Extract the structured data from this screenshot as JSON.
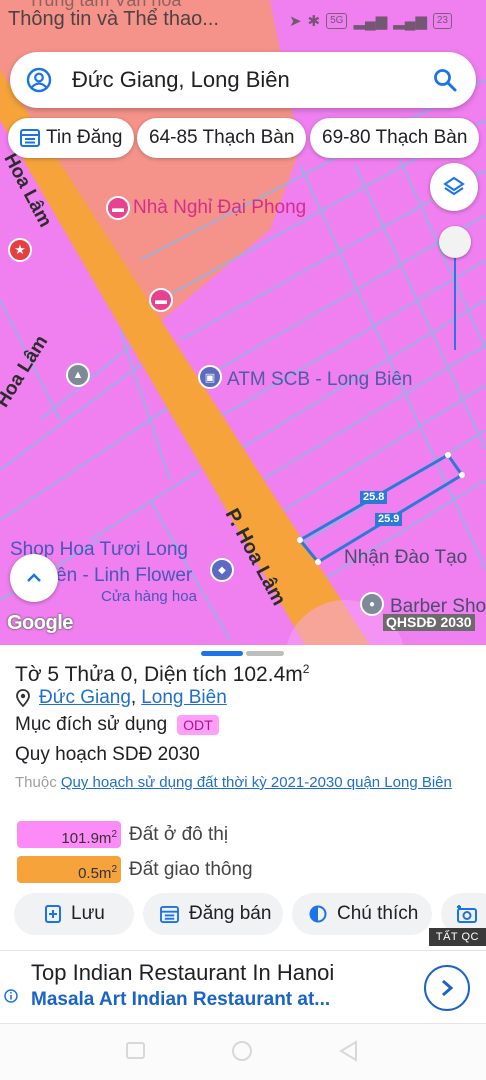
{
  "status_bar": {
    "text": "Thông tin và Thể thao...",
    "ghost_text": "Trung tâm Văn hóa",
    "network_label": "5G",
    "battery_label": "23"
  },
  "search": {
    "query": "Đức Giang, Long Biên"
  },
  "chips": [
    {
      "label": "Tin Đăng",
      "icon": "listing-icon"
    },
    {
      "label": "64-85 Thạch Bàn"
    },
    {
      "label": "69-80 Thạch Bàn"
    }
  ],
  "map": {
    "colors": {
      "residential": "#f07ff0",
      "commercial": "#f5938a",
      "road": "#f5a33a",
      "parcel_line": "#8fb6e6",
      "measure_line": "#2b7ad6"
    },
    "road_labels": [
      "Hoa Lâm",
      "Hoa Lâm",
      "P. Hoa Lâm"
    ],
    "pois": [
      {
        "name": "Nhà Nghỉ Đại Phong",
        "icon": "hotel-icon"
      },
      {
        "name": "ATM SCB - Long Biên",
        "icon": "atm-icon"
      },
      {
        "name": "Nhận Đào Tạo",
        "icon": "school-icon"
      },
      {
        "name": "Barber Sho",
        "icon": "barber-icon"
      }
    ],
    "shop": {
      "line1": "Shop Hoa Tươi Long",
      "line2": "ên - Linh Flower",
      "sub": "Cửa hàng hoa"
    },
    "measurements": [
      "25.8",
      "25.9"
    ],
    "google": "Google",
    "plan_badge": "QHSDĐ 2030"
  },
  "sheet": {
    "title_prefix": "Tờ 5 Thửa 0, Diện tích 102.4m",
    "title_sup": "2",
    "ward": "Đức Giang",
    "district": "Long Biên",
    "loc_sep": ",",
    "purpose_label": "Mục đích sử dụng",
    "purpose_code": "ODT",
    "plan_label": "Quy hoạch SDĐ 2030",
    "source_prefix": "Thuộc",
    "source_link": "Quy hoạch sử dụng đất thời kỳ 2021-2030 quận Long Biên",
    "areas": [
      {
        "value": "101.9m",
        "sup": "2",
        "name": "Đất ở đô thị",
        "color": "#fc8bf7"
      },
      {
        "value": "0.5m",
        "sup": "2",
        "name": "Đất giao thông",
        "color": "#f5a33a"
      }
    ],
    "actions": [
      {
        "label": "Lưu",
        "icon": "save-icon"
      },
      {
        "label": "Đăng bán",
        "icon": "listing-icon"
      },
      {
        "label": "Chú thích",
        "icon": "legend-icon"
      },
      {
        "label": "",
        "icon": "camera-icon"
      }
    ]
  },
  "ad": {
    "tag": "TẤT QC",
    "title": "Top Indian Restaurant In Hanoi",
    "subtitle": "Masala Art Indian Restaurant at..."
  }
}
